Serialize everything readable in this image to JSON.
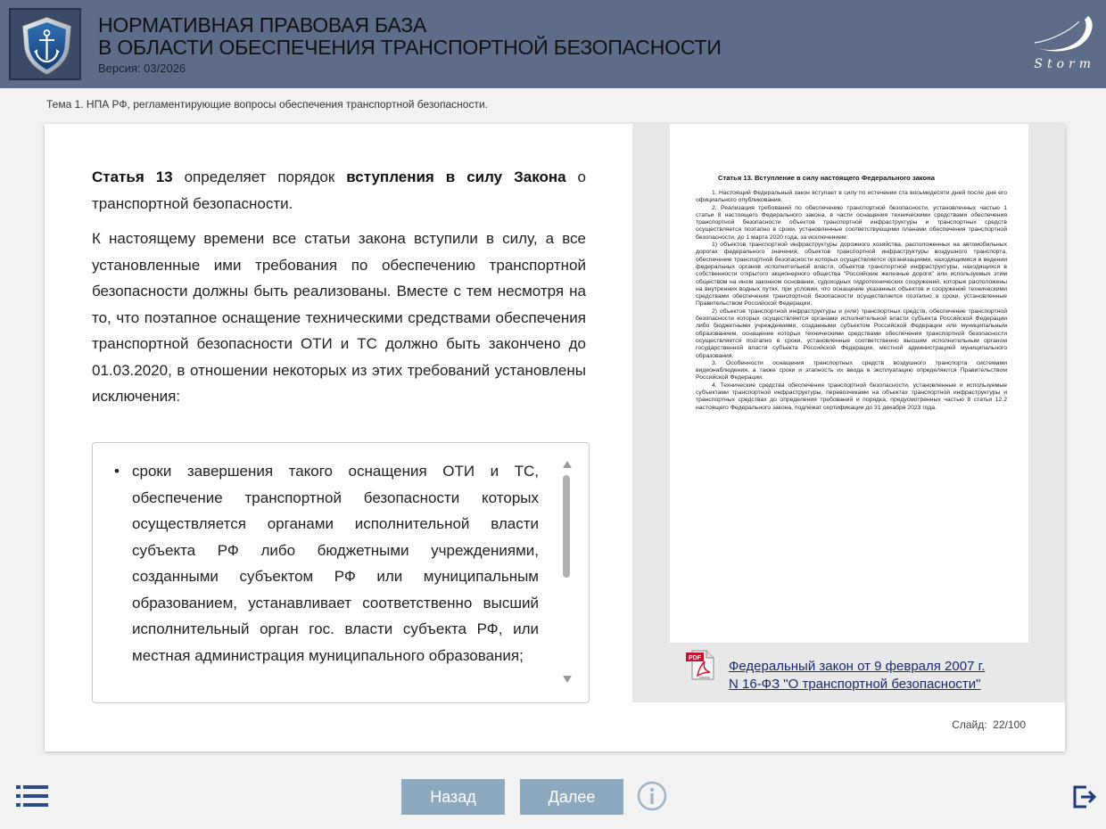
{
  "header": {
    "title_line1": "НОРМАТИВНАЯ ПРАВОВАЯ БАЗА",
    "title_line2": "В ОБЛАСТИ ОБЕСПЕЧЕНИЯ ТРАНСПОРТНОЙ БЕЗОПАСНОСТИ",
    "version": "Версия: 03/2026",
    "brand": "Storm"
  },
  "topic": "Тема 1. НПА РФ, регламентирующие вопросы обеспечения транспортной безопасности.",
  "main": {
    "intro": {
      "bold1": "Статья 13",
      "text1": " определяет порядок ",
      "bold2": "вступления в силу Закона",
      "text2": " о транспортной безопасности."
    },
    "paragraph2": "К настоящему времени все статьи закона вступили в силу, а все установленные ими требования по обеспечению транспортной безопасности должны быть реализованы. Вместе с тем несмотря на то, что поэтапное оснащение техническими средствами обеспечения транспортной безопасности ОТИ и ТС должно быть закончено до 01.03.2020, в отношении некоторых из этих требований установлены исключения:",
    "list_items": [
      "сроки завершения такого оснащения ОТИ и ТС, обеспечение транспортной безопасности которых осуществляется органами исполнительной власти субъекта РФ либо бюджетными учреждениями, созданными субъектом РФ или муниципальным образованием, устанавливает соответственно высший исполнительный орган гос. власти субъекта РФ, или местная администрация муниципального образования;"
    ]
  },
  "document": {
    "title": "Статья 13. Вступление в силу настоящего Федерального закона",
    "paragraphs": [
      "1. Настоящий Федеральный закон вступает в силу по истечении ста восьмидесяти дней после дня его официального опубликования.",
      "2. Реализация требований по обеспечению транспортной безопасности, установленных частью 1 статьи 8 настоящего Федерального закона, в части оснащения техническими средствами обеспечения транспортной безопасности объектов транспортной инфраструктуры и транспортных средств осуществляется поэтапно в сроки, установленные соответствующими планами обеспечения транспортной безопасности, до 1 марта 2020 года, за исключением:",
      "1) объектов транспортной инфраструктуры дорожного хозяйства, расположенных на автомобильных дорогах федерального значения, объектов транспортной инфраструктуры воздушного транспорта, обеспечение транспортной безопасности которых осуществляется организациями, находящимися в ведении федеральных органов исполнительной власти, объектов транспортной инфраструктуры, находящихся в собственности открытого акционерного общества \"Российские железные дороги\" или используемых этим обществом на ином законном основании, судоходных гидротехнических сооружений, которые расположены на внутренних водных путях, при условии, что оснащение указанных объектов и сооружений техническими средствами обеспечения транспортной безопасности осуществляется поэтапно в сроки, установленные Правительством Российской Федерации;",
      "2) объектов транспортной инфраструктуры и (или) транспортных средств, обеспечение транспортной безопасности которых осуществляется органами исполнительной власти субъекта Российской Федерации либо бюджетными учреждениями, созданными субъектом Российской Федерации или муниципальным образованием, оснащение которых техническими средствами обеспечения транспортной безопасности осуществляется поэтапно в сроки, установленные соответственно высшим исполнительным органом государственной власти субъекта Российской Федерации, местной администрацией муниципального образования.",
      "3. Особенности оснащения транспортных средств воздушного транспорта системами видеонаблюдения, а также сроки и этапность их ввода в эксплуатацию определяются Правительством Российской Федерации.",
      "4. Технические средства обеспечения транспортной безопасности, установленные и используемые субъектами транспортной инфраструктуры, перевозчиками на объектах транспортной инфраструктуры и транспортных средствах до определения требований и порядка, предусмотренных частью 8 статьи 12.2 настоящего Федерального закона, подлежат сертификации до 31 декабря 2023 года."
    ],
    "pdf_icon": "pdf-icon",
    "link_line1": "Федеральный закон от 9 февраля 2007 г.",
    "link_line2": "N 16-ФЗ \"О транспортной безопасности\""
  },
  "slide": {
    "label": "Слайд:",
    "current": "22",
    "separator": "/",
    "total": "100"
  },
  "nav": {
    "back": "Назад",
    "next": "Далее",
    "menu_icon": "list-menu-icon",
    "info_icon": "info-icon",
    "exit_icon": "exit-icon"
  },
  "colors": {
    "header_bg": "#5d6d89",
    "button_bg": "#8da9bf",
    "link": "#1a2a6a"
  }
}
